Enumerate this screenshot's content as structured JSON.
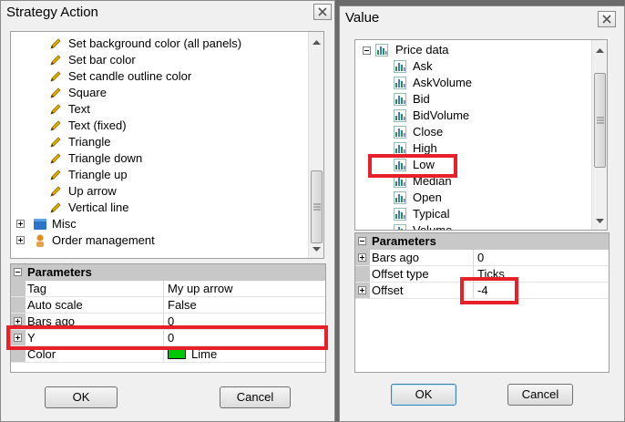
{
  "left_dialog": {
    "title": "Strategy Action",
    "tree_items": [
      "Set background color (all panels)",
      "Set bar color",
      "Set candle outline color",
      "Square",
      "Text",
      "Text (fixed)",
      "Triangle",
      "Triangle down",
      "Triangle up",
      "Up arrow",
      "Vertical line"
    ],
    "groups": [
      "Misc",
      "Order management"
    ],
    "params_header": "Parameters",
    "params": [
      {
        "name": "Tag",
        "value": "My up arrow"
      },
      {
        "name": "Auto scale",
        "value": "False"
      },
      {
        "name": "Bars ago",
        "value": "0"
      },
      {
        "name": "Y",
        "value": "0"
      },
      {
        "name": "Color",
        "value": "Lime"
      }
    ],
    "color_swatch": "#00c800",
    "ok_label": "OK",
    "cancel_label": "Cancel"
  },
  "right_dialog": {
    "title": "Value",
    "root": "Price data",
    "items": [
      "Ask",
      "AskVolume",
      "Bid",
      "BidVolume",
      "Close",
      "High",
      "Low",
      "Median",
      "Open",
      "Typical",
      "Volume"
    ],
    "params_header": "Parameters",
    "params": [
      {
        "name": "Bars ago",
        "value": "0"
      },
      {
        "name": "Offset type",
        "value": "Ticks"
      },
      {
        "name": "Offset",
        "value": "-4"
      }
    ],
    "ok_label": "OK",
    "cancel_label": "Cancel"
  },
  "colors": {
    "highlight": "#e8202a",
    "pencil": "#e0b000",
    "chart_icon": "#2e8b57"
  }
}
